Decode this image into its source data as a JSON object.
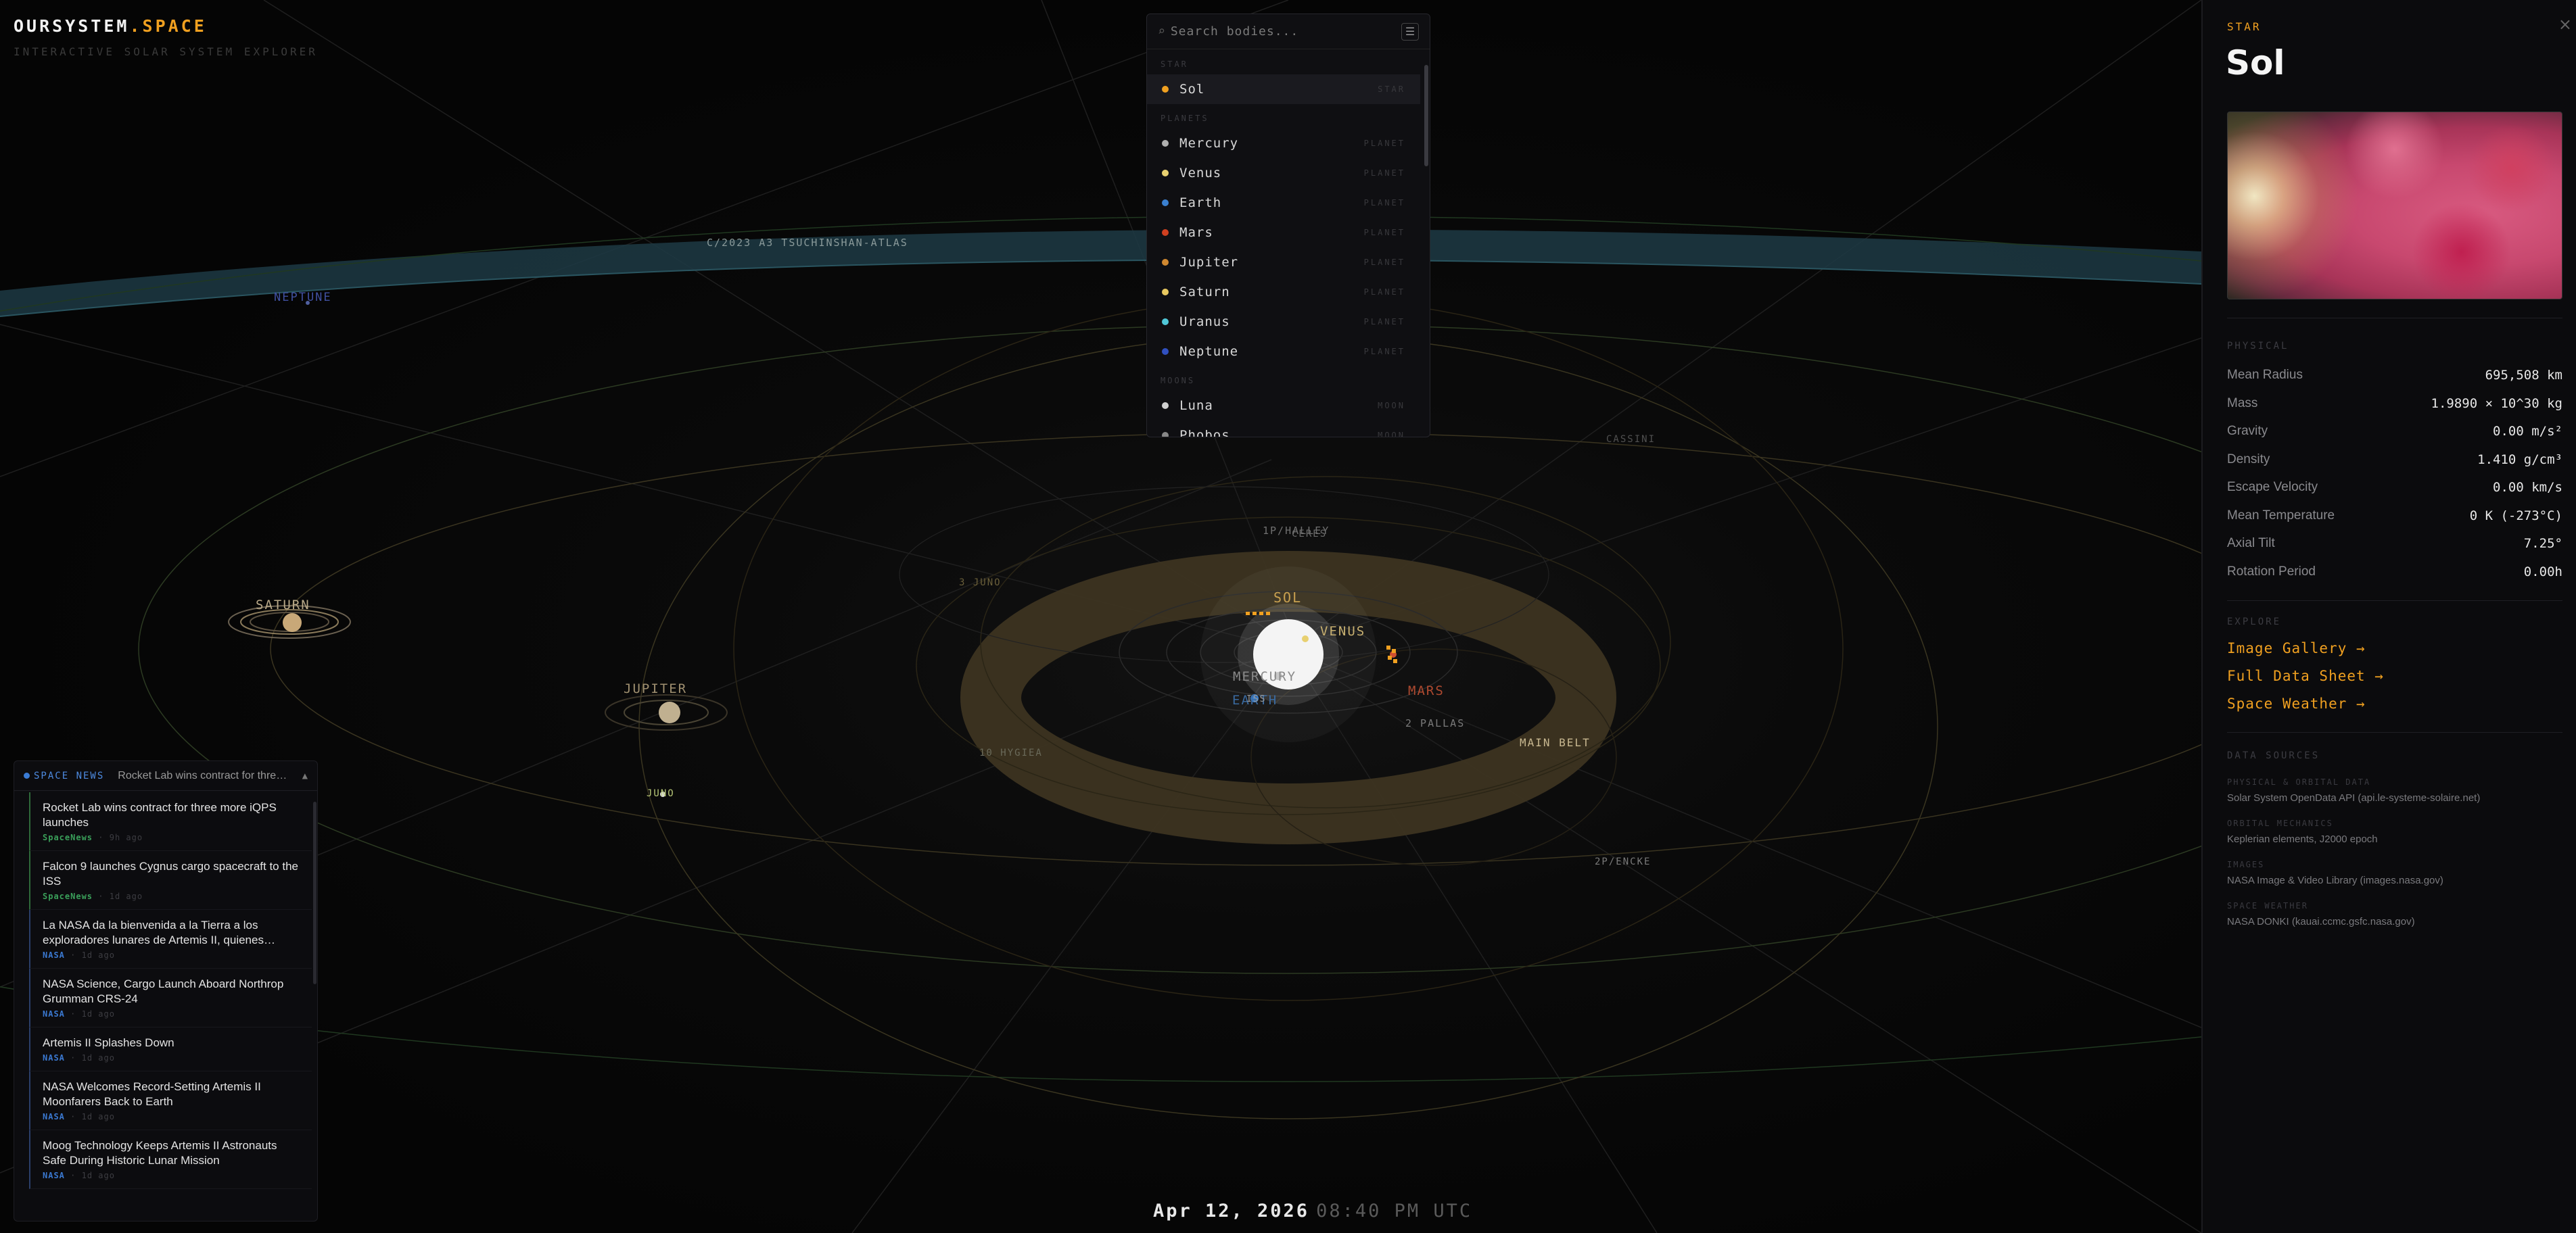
{
  "brand": {
    "name": "OURSYSTEM",
    "suffix": ".SPACE",
    "tagline": "INTERACTIVE SOLAR SYSTEM EXPLORER"
  },
  "search": {
    "placeholder": "Search bodies...",
    "groups": [
      {
        "title": "STAR",
        "items": [
          {
            "name": "Sol",
            "type": "STAR",
            "color": "#f0a020"
          }
        ]
      },
      {
        "title": "PLANETS",
        "items": [
          {
            "name": "Mercury",
            "type": "PLANET",
            "color": "#b0b0b0"
          },
          {
            "name": "Venus",
            "type": "PLANET",
            "color": "#e8d070"
          },
          {
            "name": "Earth",
            "type": "PLANET",
            "color": "#3a80d0"
          },
          {
            "name": "Mars",
            "type": "PLANET",
            "color": "#d04020"
          },
          {
            "name": "Jupiter",
            "type": "PLANET",
            "color": "#d08830"
          },
          {
            "name": "Saturn",
            "type": "PLANET",
            "color": "#e8c860"
          },
          {
            "name": "Uranus",
            "type": "PLANET",
            "color": "#50c8d8"
          },
          {
            "name": "Neptune",
            "type": "PLANET",
            "color": "#3050c0"
          }
        ]
      },
      {
        "title": "MOONS",
        "items": [
          {
            "name": "Luna",
            "type": "MOON",
            "color": "#d0d0d0"
          },
          {
            "name": "Phobos",
            "type": "MOON",
            "color": "#888888"
          }
        ]
      }
    ]
  },
  "scene": {
    "labels": {
      "comet_atlas": "C/2023 A3 TSUCHINSHAN-ATLAS",
      "neptune": "NEPTUNE",
      "cassini": "CASSINI",
      "halley": "1P/HALLEY",
      "ceres": "CERES",
      "juno_asteroid": "3 JUNO",
      "sol": "SOL",
      "venus": "VENUS",
      "mercury": "MERCURY",
      "earth": "EARTH",
      "iss": "ISS",
      "mars": "MARS",
      "pallas": "2 PALLAS",
      "hygiea": "10 HYGIEA",
      "main_belt": "MAIN BELT",
      "encke": "2P/ENCKE",
      "saturn": "SATURN",
      "jupiter": "JUPITER",
      "juno_probe": "JUNO"
    }
  },
  "news": {
    "label": "SPACE NEWS",
    "ticker": "Rocket Lab wins contract for three more iQPS launches",
    "collapse_icon": "▲",
    "items": [
      {
        "headline": "Rocket Lab wins contract for three more iQPS launches",
        "source": "SpaceNews",
        "age": "9h ago",
        "kind": "spacenews"
      },
      {
        "headline": "Falcon 9 launches Cygnus cargo spacecraft to the ISS",
        "source": "SpaceNews",
        "age": "1d ago",
        "kind": "spacenews"
      },
      {
        "headline": "La NASA da la bienvenida a la Tierra a los exploradores lunares de Artemis II, quienes…",
        "source": "NASA",
        "age": "1d ago",
        "kind": "nasa"
      },
      {
        "headline": "NASA Science, Cargo Launch Aboard Northrop Grumman CRS-24",
        "source": "NASA",
        "age": "1d ago",
        "kind": "nasa"
      },
      {
        "headline": "Artemis II Splashes Down",
        "source": "NASA",
        "age": "1d ago",
        "kind": "nasa"
      },
      {
        "headline": "NASA Welcomes Record-Setting Artemis II Moonfarers Back to Earth",
        "source": "NASA",
        "age": "1d ago",
        "kind": "nasa"
      },
      {
        "headline": "Moog Technology Keeps Artemis II Astronauts Safe During Historic Lunar Mission",
        "source": "NASA",
        "age": "1d ago",
        "kind": "nasa"
      }
    ]
  },
  "datetime": {
    "date": "Apr 12, 2026",
    "time": "08:40 PM UTC"
  },
  "detail": {
    "type": "STAR",
    "name": "Sol",
    "close_icon": "×",
    "physical_title": "PHYSICAL",
    "stats": [
      {
        "label": "Mean Radius",
        "value": "695,508 km"
      },
      {
        "label": "Mass",
        "value": "1.9890 × 10^30 kg"
      },
      {
        "label": "Gravity",
        "value": "0.00 m/s²"
      },
      {
        "label": "Density",
        "value": "1.410 g/cm³"
      },
      {
        "label": "Escape Velocity",
        "value": "0.00 km/s"
      },
      {
        "label": "Mean Temperature",
        "value": "0 K (-273°C)"
      },
      {
        "label": "Axial Tilt",
        "value": "7.25°"
      },
      {
        "label": "Rotation Period",
        "value": "0.00h"
      }
    ],
    "explore_title": "EXPLORE",
    "explore_links": [
      "Image Gallery →",
      "Full Data Sheet →",
      "Space Weather →"
    ],
    "sources_title": "DATA SOURCES",
    "sources": [
      {
        "label": "PHYSICAL & ORBITAL DATA",
        "value": "Solar System OpenData API (api.le-systeme-solaire.net)"
      },
      {
        "label": "ORBITAL MECHANICS",
        "value": "Keplerian elements, J2000 epoch"
      },
      {
        "label": "IMAGES",
        "value": "NASA Image & Video Library (images.nasa.gov)"
      },
      {
        "label": "SPACE WEATHER",
        "value": "NASA DONKI (kauai.ccmc.gsfc.nasa.gov)"
      }
    ]
  },
  "colors": {
    "accent": "#f0a020",
    "nasa": "#3a78d0",
    "spacenews": "#3aa05a"
  }
}
